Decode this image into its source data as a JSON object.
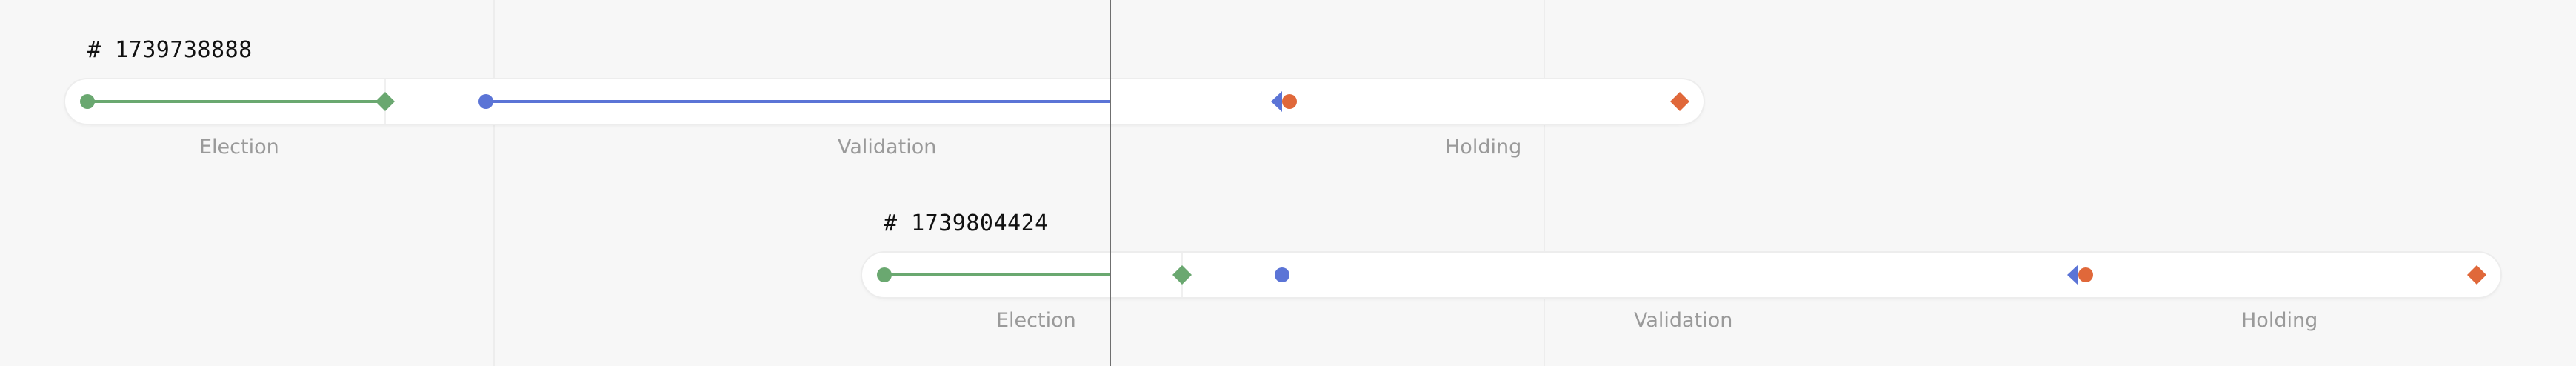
{
  "colors": {
    "election": "#6aa870",
    "validation": "#5b74d6",
    "holding": "#e0683a",
    "now_line": "#6f6f6f",
    "track": "#ffffff",
    "label": "#9a9a9a"
  },
  "icons": {
    "start_marker": "circle",
    "end_marker": "diamond",
    "validation_end_marker": "left-arrow"
  },
  "timelines": [
    {
      "id_label": "# 1739738888",
      "phases": {
        "election": "Election",
        "validation": "Validation",
        "holding": "Holding"
      }
    },
    {
      "id_label": "# 1739804424",
      "phases": {
        "election": "Election",
        "validation": "Validation",
        "holding": "Holding"
      }
    }
  ]
}
